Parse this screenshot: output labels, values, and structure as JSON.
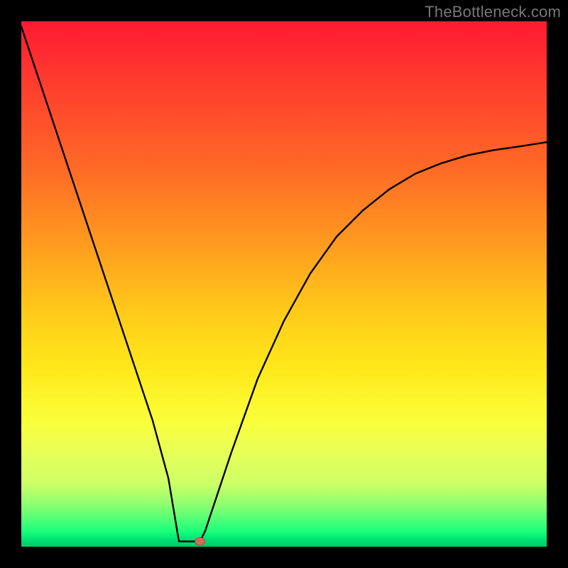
{
  "watermark": "TheBottleneck.com",
  "colors": {
    "background": "#000000",
    "curve": "#000000",
    "marker_fill": "#d46a5a",
    "marker_stroke": "#a04438"
  },
  "chart_data": {
    "type": "line",
    "title": "",
    "xlabel": "",
    "ylabel": "",
    "xlim": [
      0,
      100
    ],
    "ylim": [
      0,
      100
    ],
    "series": [
      {
        "name": "bottleneck-curve",
        "x": [
          0,
          5,
          10,
          15,
          20,
          25,
          28,
          30,
          32,
          34,
          35,
          40,
          45,
          50,
          55,
          60,
          65,
          70,
          75,
          80,
          85,
          90,
          95,
          100
        ],
        "values": [
          99,
          84,
          69,
          54,
          39,
          24,
          13,
          4,
          1,
          1,
          3,
          18,
          32,
          43,
          52,
          59,
          64,
          68,
          71,
          73,
          74.5,
          75.5,
          76.2,
          77
        ]
      }
    ],
    "flat_bottom": {
      "x_start": 30,
      "x_end": 34,
      "y": 1
    },
    "marker": {
      "x": 34,
      "y": 1
    }
  }
}
